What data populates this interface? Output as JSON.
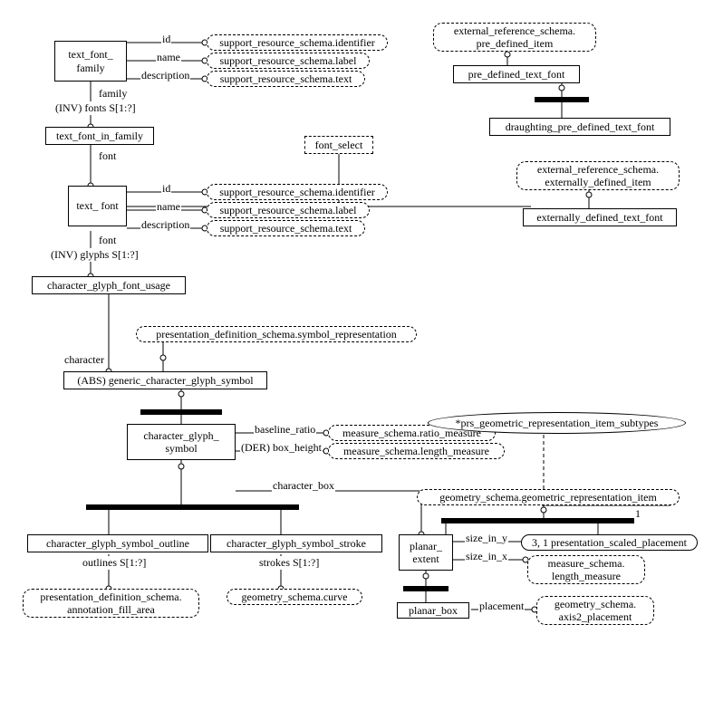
{
  "diagram": {
    "entities": {
      "text_font_family": "text_font_\nfamily",
      "text_font_in_family": "text_font_in_family",
      "text_font": "text_\nfont",
      "character_glyph_font_usage": "character_glyph_font_usage",
      "generic_character_glyph_symbol": "(ABS) generic_character_glyph_symbol",
      "character_glyph_symbol": "character_glyph_\nsymbol",
      "character_glyph_symbol_outline": "character_glyph_symbol_outline",
      "character_glyph_symbol_stroke": "character_glyph_symbol_stroke",
      "planar_extent": "planar_\nextent",
      "planar_box": "planar_box",
      "pre_defined_text_font": "pre_defined_text_font",
      "draughting_pre_defined_text_font": "draughting_pre_defined_text_font",
      "externally_defined_text_font": "externally_defined_text_font",
      "font_select": "font_select"
    },
    "external_types": {
      "srs_identifier": "support_resource_schema.identifier",
      "srs_label": "support_resource_schema.label",
      "srs_text": "support_resource_schema.text",
      "ers_pre_defined_item": "external_reference_schema.\npre_defined_item",
      "ers_externally_defined_item": "external_reference_schema.\nexternally_defined_item",
      "pds_symbol_representation": "presentation_definition_schema.symbol_representation",
      "pds_annotation_fill_area": "presentation_definition_schema.\nannotation_fill_area",
      "geometry_schema_curve": "geometry_schema.curve",
      "ms_ratio_measure": "measure_schema.ratio_measure",
      "ms_length_measure": "measure_schema.length_measure",
      "ms_length_measure2": "measure_schema.\nlength_measure",
      "gs_gri": "geometry_schema.geometric_representation_item",
      "gs_axis2_placement": "geometry_schema.\naxis2_placement",
      "prs_subtypes": "*prs_geometric_representation_item_subtypes",
      "presentation_scaled_placement": "3, 1 presentation_scaled_placement"
    },
    "attributes": {
      "id1": "id",
      "name1": "name",
      "description1": "description",
      "family": "family",
      "inv_fonts": "(INV) fonts S[1:?]",
      "font1": "font",
      "id2": "id",
      "name2": "name",
      "description2": "description",
      "font2": "font",
      "inv_glyphs": "(INV) glyphs S[1:?]",
      "character": "character",
      "baseline_ratio": "baseline_ratio",
      "der_box_height": "(DER) box_height",
      "character_box": "character_box",
      "outlines": "outlines S[1:?]",
      "strokes": "strokes S[1:?]",
      "size_in_y": "size_in_y",
      "size_in_x": "size_in_x",
      "placement": "placement",
      "one": "1"
    }
  }
}
